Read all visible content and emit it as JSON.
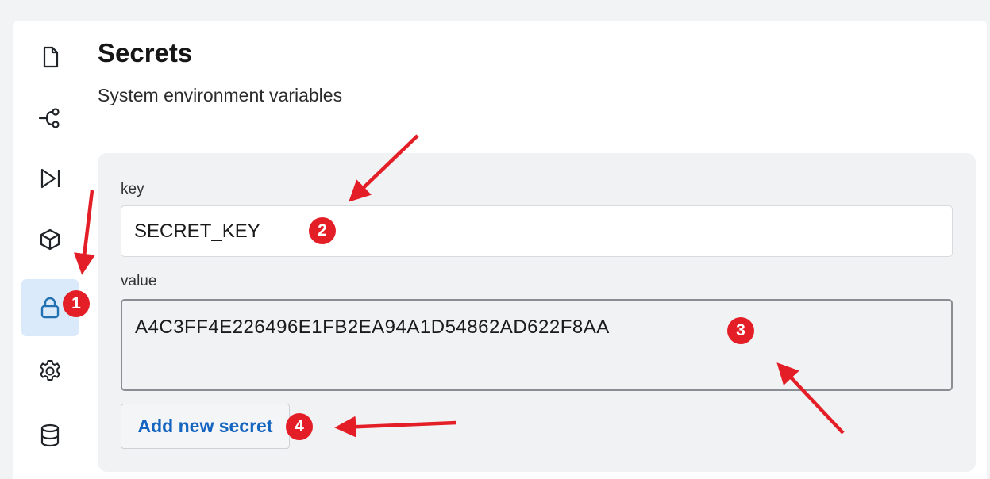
{
  "sidebar": {
    "items": [
      {
        "icon": "file-icon"
      },
      {
        "icon": "branch-icon"
      },
      {
        "icon": "play-step-icon"
      },
      {
        "icon": "cube-icon"
      },
      {
        "icon": "lock-icon",
        "active": true
      },
      {
        "icon": "gear-icon"
      },
      {
        "icon": "database-icon"
      }
    ]
  },
  "header": {
    "title": "Secrets",
    "subtitle": "System environment variables"
  },
  "form": {
    "key_label": "key",
    "key_value": "SECRET_KEY",
    "value_label": "value",
    "value_value": "A4C3FF4E226496E1FB2EA94A1D54862AD622F8AA",
    "add_button_label": "Add new secret"
  },
  "annotations": {
    "badge_1": "1",
    "badge_2": "2",
    "badge_3": "3",
    "badge_4": "4",
    "color": "#e41e26"
  },
  "colors": {
    "accent": "#1565c0",
    "active_bg": "#dbeafb"
  }
}
